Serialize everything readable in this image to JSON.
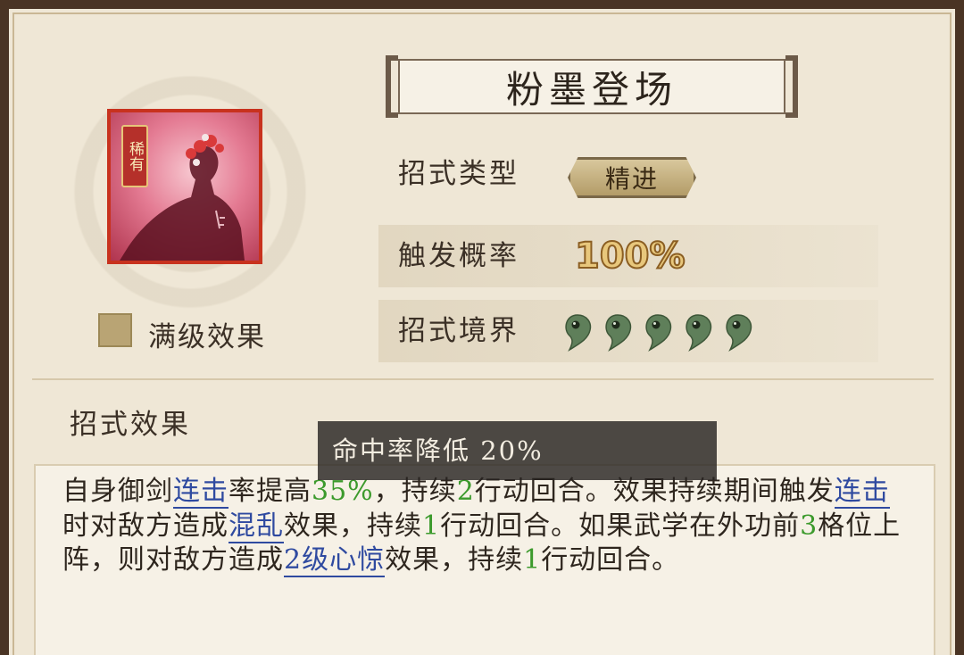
{
  "skill": {
    "title": "粉墨登场",
    "rarity": "稀有",
    "max_level_label": "满级效果"
  },
  "rows": {
    "type_label": "招式类型",
    "type_value": "精进",
    "chance_label": "触发概率",
    "chance_value": "100%",
    "realm_label": "招式境界",
    "realm_beads": 5
  },
  "effect": {
    "section_title": "招式效果",
    "tooltip": "命中率降低 20%",
    "segments": [
      {
        "t": "自身御剑",
        "k": "n"
      },
      {
        "t": "连击",
        "k": "link"
      },
      {
        "t": "率提高",
        "k": "n"
      },
      {
        "t": "35%",
        "k": "g"
      },
      {
        "t": "，持续",
        "k": "n"
      },
      {
        "t": "2",
        "k": "g"
      },
      {
        "t": "行动回合。效果持续期间触发",
        "k": "n"
      },
      {
        "t": "连击",
        "k": "link"
      },
      {
        "t": "时对敌方造成",
        "k": "n"
      },
      {
        "t": "混乱",
        "k": "link"
      },
      {
        "t": "效果，持续",
        "k": "n"
      },
      {
        "t": "1",
        "k": "g"
      },
      {
        "t": "行动回合。如果武学在外功前",
        "k": "n"
      },
      {
        "t": "3",
        "k": "g"
      },
      {
        "t": "格位上阵，则对敌方造成",
        "k": "n"
      },
      {
        "t": "2级心惊",
        "k": "link"
      },
      {
        "t": "效果，持续",
        "k": "n"
      },
      {
        "t": "1",
        "k": "g"
      },
      {
        "t": "行动回合。",
        "k": "n"
      }
    ]
  },
  "colors": {
    "green_value": "#3c9a2c",
    "link_blue": "#2f4aa0",
    "bead_jade": "#5f7f5a"
  }
}
